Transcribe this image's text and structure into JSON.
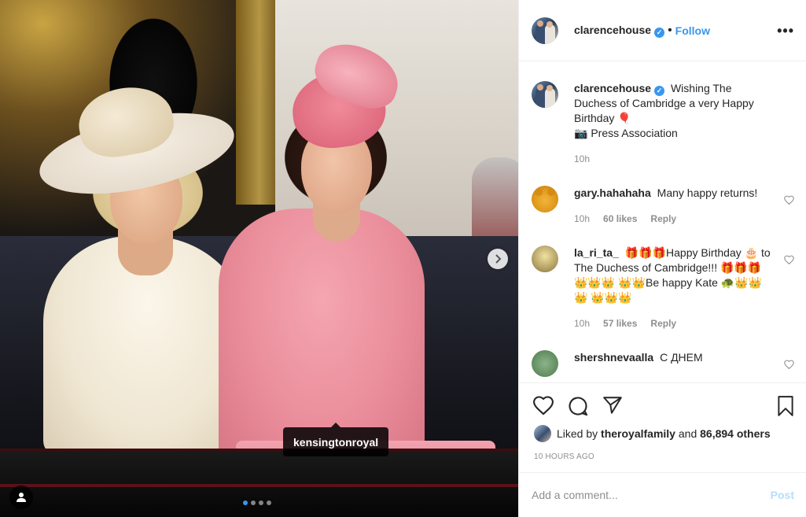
{
  "post": {
    "image_tag": "kensingtonroyal",
    "carousel": {
      "count": 4,
      "active": 0
    }
  },
  "header": {
    "username": "clarencehouse",
    "verified_glyph": "✓",
    "separator": "•",
    "follow_label": "Follow",
    "more_label": "•••"
  },
  "caption": {
    "username": "clarencehouse",
    "line1": "Wishing The Duchess of Cambridge a very Happy Birthday 🎈",
    "line2": "📷 Press Association",
    "time": "10h"
  },
  "comments": [
    {
      "username": "gary.hahahaha",
      "text": "Many happy returns!",
      "time": "10h",
      "likes": "60 likes",
      "reply": "Reply"
    },
    {
      "username": "la_ri_ta_",
      "text": "🎁🎁🎁Happy Birthday 🎂 to The Duchess of Cambridge!!! 🎁🎁🎁 👑👑👑 👑👑Be happy Kate 🐢👑👑👑 👑👑👑",
      "time": "10h",
      "likes": "57 likes",
      "reply": "Reply"
    },
    {
      "username": "shershnevaalla",
      "text": "С ДНЕМ"
    }
  ],
  "likes": {
    "prefix": "Liked by",
    "user": "theroyalfamily",
    "and": "and",
    "others": "86,894 others"
  },
  "timestamp": "10 HOURS AGO",
  "comment_box": {
    "placeholder": "Add a comment...",
    "post_label": "Post"
  },
  "icons": {
    "like": "heart-icon",
    "comment": "comment-bubble-icon",
    "share": "paper-plane-icon",
    "save": "bookmark-icon",
    "next": "chevron-right-icon",
    "tagged_users": "person-icon"
  },
  "colors": {
    "accent": "#3897f0",
    "post_disabled": "#b2dffc",
    "muted": "#8e8e8e",
    "text": "#262626"
  }
}
